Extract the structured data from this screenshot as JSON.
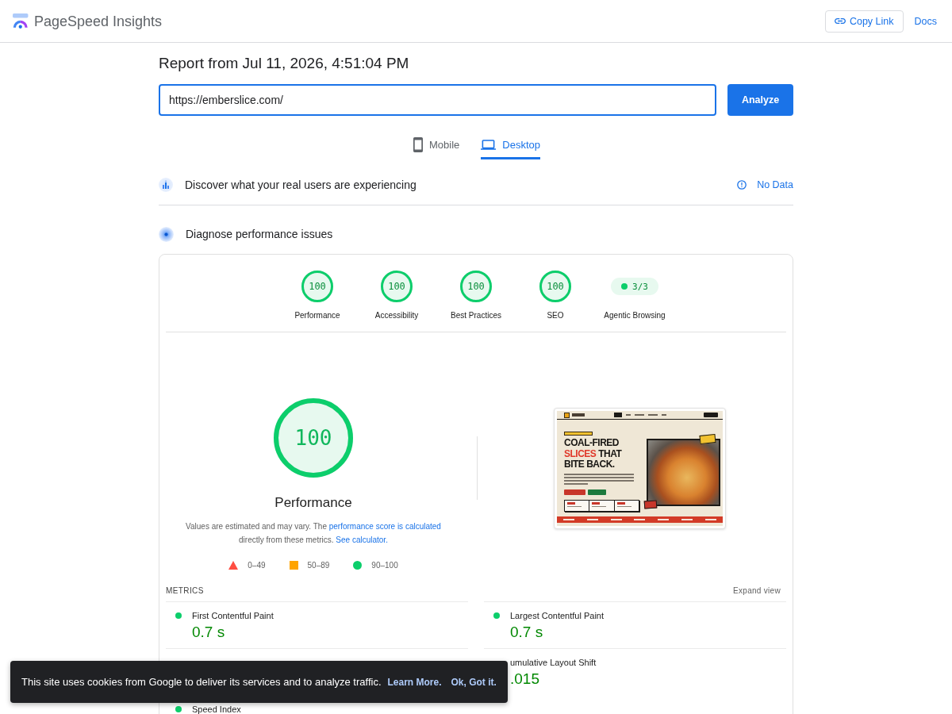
{
  "header": {
    "title": "PageSpeed Insights",
    "copy_link": "Copy Link",
    "docs": "Docs"
  },
  "report": {
    "title": "Report from Jul 11, 2026, 4:51:04 PM",
    "url": "https://emberslice.com/",
    "analyze": "Analyze"
  },
  "tabs": [
    {
      "kind": "mobile",
      "label": "Mobile",
      "selected": false
    },
    {
      "kind": "desktop",
      "label": "Desktop",
      "selected": true
    }
  ],
  "field_data": {
    "title": "Discover what your real users are experiencing",
    "status": "No Data"
  },
  "lab": {
    "title": "Diagnose performance issues",
    "categories": [
      {
        "kind": "gauge",
        "score": "100",
        "level": 1,
        "label": "Performance"
      },
      {
        "kind": "gauge",
        "score": "100",
        "level": 1,
        "label": "Accessibility"
      },
      {
        "kind": "gauge",
        "score": "100",
        "level": 1,
        "label": "Best Practices"
      },
      {
        "kind": "gauge",
        "score": "100",
        "level": 1,
        "label": "SEO"
      },
      {
        "kind": "fraction",
        "score": "3/3",
        "color": "#0cce6b",
        "label": "Agentic Browsing"
      }
    ],
    "performance": {
      "score": "100",
      "level": 1,
      "title": "Performance",
      "description": [
        {
          "kind": "text",
          "text": "Values are estimated and may vary. The "
        },
        {
          "kind": "link",
          "text": "performance score is calculated"
        },
        {
          "kind": "text",
          "text": " directly from these metrics. "
        },
        {
          "kind": "link",
          "text": "See calculator."
        }
      ],
      "legend": [
        {
          "kind": "fail",
          "label": "0–49",
          "color": "#ff4e42"
        },
        {
          "kind": "average",
          "label": "50–89",
          "color": "#ffa400"
        },
        {
          "kind": "pass",
          "label": "90–100",
          "color": "#0cce6b"
        }
      ]
    },
    "screenshot": {
      "headline": [
        [
          {
            "text": "COAL-FIRED",
            "color": "#171512"
          }
        ],
        [
          {
            "text": "SLICES",
            "color": "#e0392a"
          },
          {
            "text": "THAT",
            "color": "#171512"
          }
        ],
        [
          {
            "text": "BITE BACK.",
            "color": "#171512"
          }
        ]
      ]
    },
    "metrics": {
      "title": "METRICS",
      "expand": "Expand view",
      "items": [
        {
          "kind": "metric",
          "label": "First Contentful Paint",
          "value": "0.7 s",
          "color": "#0cce6b"
        },
        {
          "kind": "metric",
          "label": "Largest Contentful Paint",
          "value": "0.7 s",
          "color": "#0cce6b"
        },
        {
          "kind": "covered"
        },
        {
          "kind": "metric",
          "label": "umulative Layout Shift",
          "value": ".015"
        },
        {
          "kind": "metric",
          "label": "Speed Index",
          "color": "#0cce6b"
        }
      ]
    }
  },
  "cookie_banner": {
    "message": "This site uses cookies from Google to deliver its services and to analyze traffic.",
    "learn_more": "Learn More.",
    "ok": "Ok, Got it."
  }
}
